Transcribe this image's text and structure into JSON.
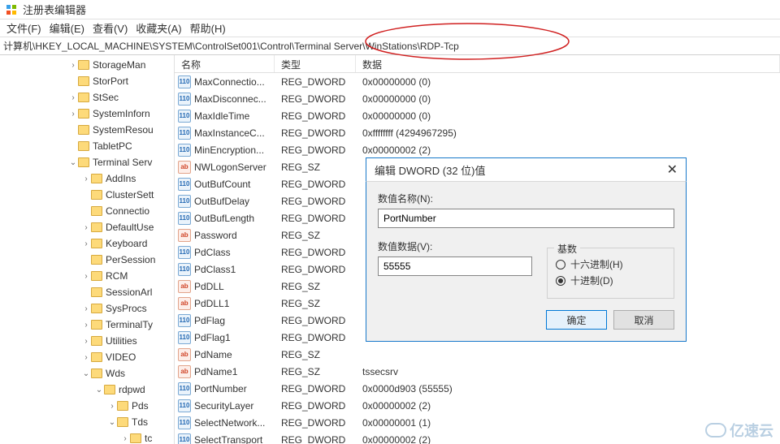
{
  "window": {
    "title": "注册表编辑器"
  },
  "menu": {
    "file": "文件(F)",
    "edit": "编辑(E)",
    "view": "查看(V)",
    "fav": "收藏夹(A)",
    "help": "帮助(H)"
  },
  "address": "计算机\\HKEY_LOCAL_MACHINE\\SYSTEM\\ControlSet001\\Control\\Terminal Server\\WinStations\\RDP-Tcp",
  "columns": {
    "name": "名称",
    "type": "类型",
    "data": "数据"
  },
  "tree": [
    {
      "indent": 84,
      "tw": ">",
      "label": "StorageMan"
    },
    {
      "indent": 84,
      "tw": "",
      "label": "StorPort"
    },
    {
      "indent": 84,
      "tw": ">",
      "label": "StSec"
    },
    {
      "indent": 84,
      "tw": ">",
      "label": "SystemInforn"
    },
    {
      "indent": 84,
      "tw": "",
      "label": "SystemResou"
    },
    {
      "indent": 84,
      "tw": "",
      "label": "TabletPC"
    },
    {
      "indent": 84,
      "tw": "v",
      "label": "Terminal Serv"
    },
    {
      "indent": 100,
      "tw": ">",
      "label": "AddIns"
    },
    {
      "indent": 100,
      "tw": "",
      "label": "ClusterSett"
    },
    {
      "indent": 100,
      "tw": "",
      "label": "Connectio"
    },
    {
      "indent": 100,
      "tw": ">",
      "label": "DefaultUse"
    },
    {
      "indent": 100,
      "tw": ">",
      "label": "Keyboard"
    },
    {
      "indent": 100,
      "tw": "",
      "label": "PerSession"
    },
    {
      "indent": 100,
      "tw": ">",
      "label": "RCM"
    },
    {
      "indent": 100,
      "tw": "",
      "label": "SessionArl"
    },
    {
      "indent": 100,
      "tw": ">",
      "label": "SysProcs"
    },
    {
      "indent": 100,
      "tw": ">",
      "label": "TerminalTy"
    },
    {
      "indent": 100,
      "tw": ">",
      "label": "Utilities"
    },
    {
      "indent": 100,
      "tw": ">",
      "label": "VIDEO"
    },
    {
      "indent": 100,
      "tw": "v",
      "label": "Wds"
    },
    {
      "indent": 116,
      "tw": "v",
      "label": "rdpwd"
    },
    {
      "indent": 132,
      "tw": ">",
      "label": "Pds"
    },
    {
      "indent": 132,
      "tw": "v",
      "label": "Tds"
    },
    {
      "indent": 148,
      "tw": ">",
      "label": "tc"
    }
  ],
  "rows": [
    {
      "icon": "bin",
      "name": "MaxConnectio...",
      "type": "REG_DWORD",
      "data": "0x00000000 (0)"
    },
    {
      "icon": "bin",
      "name": "MaxDisconnec...",
      "type": "REG_DWORD",
      "data": "0x00000000 (0)"
    },
    {
      "icon": "bin",
      "name": "MaxIdleTime",
      "type": "REG_DWORD",
      "data": "0x00000000 (0)"
    },
    {
      "icon": "bin",
      "name": "MaxInstanceC...",
      "type": "REG_DWORD",
      "data": "0xffffffff (4294967295)"
    },
    {
      "icon": "bin",
      "name": "MinEncryption...",
      "type": "REG_DWORD",
      "data": "0x00000002 (2)"
    },
    {
      "icon": "str",
      "name": "NWLogonServer",
      "type": "REG_SZ",
      "data": ""
    },
    {
      "icon": "bin",
      "name": "OutBufCount",
      "type": "REG_DWORD",
      "data": ""
    },
    {
      "icon": "bin",
      "name": "OutBufDelay",
      "type": "REG_DWORD",
      "data": ""
    },
    {
      "icon": "bin",
      "name": "OutBufLength",
      "type": "REG_DWORD",
      "data": ""
    },
    {
      "icon": "str",
      "name": "Password",
      "type": "REG_SZ",
      "data": ""
    },
    {
      "icon": "bin",
      "name": "PdClass",
      "type": "REG_DWORD",
      "data": ""
    },
    {
      "icon": "bin",
      "name": "PdClass1",
      "type": "REG_DWORD",
      "data": ""
    },
    {
      "icon": "str",
      "name": "PdDLL",
      "type": "REG_SZ",
      "data": ""
    },
    {
      "icon": "str",
      "name": "PdDLL1",
      "type": "REG_SZ",
      "data": ""
    },
    {
      "icon": "bin",
      "name": "PdFlag",
      "type": "REG_DWORD",
      "data": ""
    },
    {
      "icon": "bin",
      "name": "PdFlag1",
      "type": "REG_DWORD",
      "data": ""
    },
    {
      "icon": "str",
      "name": "PdName",
      "type": "REG_SZ",
      "data": ""
    },
    {
      "icon": "str",
      "name": "PdName1",
      "type": "REG_SZ",
      "data": "tssecsrv"
    },
    {
      "icon": "bin",
      "name": "PortNumber",
      "type": "REG_DWORD",
      "data": "0x0000d903 (55555)"
    },
    {
      "icon": "bin",
      "name": "SecurityLayer",
      "type": "REG_DWORD",
      "data": "0x00000002 (2)"
    },
    {
      "icon": "bin",
      "name": "SelectNetwork...",
      "type": "REG_DWORD",
      "data": "0x00000001 (1)"
    },
    {
      "icon": "bin",
      "name": "SelectTransport",
      "type": "REG_DWORD",
      "data": "0x00000002 (2)"
    }
  ],
  "dialog": {
    "title": "编辑 DWORD (32 位)值",
    "name_label": "数值名称(N):",
    "name_value": "PortNumber",
    "data_label": "数值数据(V):",
    "data_value": "55555",
    "base_label": "基数",
    "radio_hex": "十六进制(H)",
    "radio_dec": "十进制(D)",
    "ok": "确定",
    "cancel": "取消"
  },
  "watermark": "亿速云"
}
